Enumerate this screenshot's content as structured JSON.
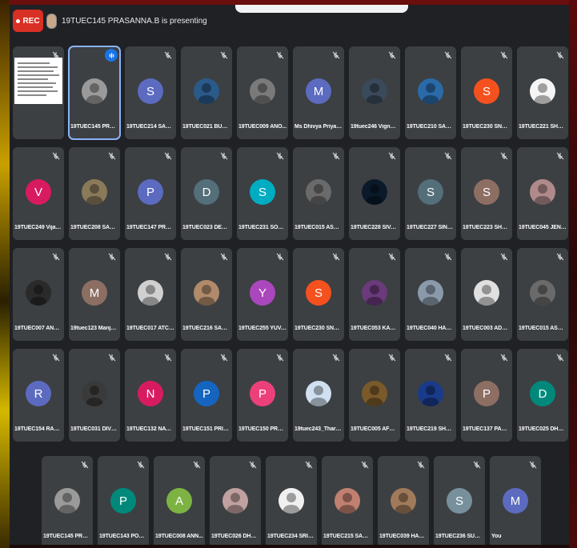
{
  "recording": {
    "label": "REC"
  },
  "presenting": {
    "text": "19TUEC145 PRASANNA.B is presenting"
  },
  "colors": {
    "background": "#202124",
    "tile": "#3c4043",
    "accent": "#1a73e8",
    "rec": "#d93025"
  },
  "participants": [
    {
      "name": "",
      "kind": "share",
      "mic": "muted"
    },
    {
      "name": "19TUEC145 PRASA...",
      "kind": "photo",
      "color": "#9a9a9a",
      "mic": "speaking",
      "selected": true
    },
    {
      "name": "19TUEC214 SARAN...",
      "kind": "letter",
      "letter": "S",
      "color": "#5c6bc0",
      "mic": "muted"
    },
    {
      "name": "19TUEC021 BUMIC...",
      "kind": "photo",
      "color": "#2a5a8a",
      "mic": "muted"
    },
    {
      "name": "19TUEC009 ANO...",
      "kind": "photo",
      "color": "#7a7a7a",
      "mic": "muted"
    },
    {
      "name": "Ms Dhivya Priya E ...",
      "kind": "letter",
      "letter": "M",
      "color": "#5c6bc0",
      "mic": "muted"
    },
    {
      "name": "19tuec246 Vignea...",
      "kind": "photo",
      "color": "#3a4a5a",
      "mic": "muted"
    },
    {
      "name": "19TUEC210 SANJA...",
      "kind": "photo",
      "color": "#2a6aa8",
      "mic": "muted"
    },
    {
      "name": "19TUEC230 SNEH...",
      "kind": "letter",
      "letter": "S",
      "color": "#f4511e",
      "mic": "muted"
    },
    {
      "name": "19TUEC221 SHAN...",
      "kind": "photo",
      "color": "#f5f5f5",
      "mic": "muted"
    },
    {
      "name": "19TUEC249 Vijaya...",
      "kind": "letter",
      "letter": "V",
      "color": "#d81b60",
      "mic": "muted"
    },
    {
      "name": "19TUEC208 SAMU...",
      "kind": "photo",
      "color": "#8a7a5a",
      "mic": "muted"
    },
    {
      "name": "19TUEC147 PRAVE...",
      "kind": "letter",
      "letter": "P",
      "color": "#5c6bc0",
      "mic": "muted"
    },
    {
      "name": "19TUEC023 DEEPI...",
      "kind": "letter",
      "letter": "D",
      "color": "#546e7a",
      "mic": "muted"
    },
    {
      "name": "19TUEC231 SOBIH...",
      "kind": "letter",
      "letter": "S",
      "color": "#00acc1",
      "mic": "muted"
    },
    {
      "name": "19TUEC015 ASWI...",
      "kind": "photo",
      "color": "#6a6a6a",
      "mic": "muted"
    },
    {
      "name": "19TUEC228 SIVANI...",
      "kind": "photo",
      "color": "#0a1a2a",
      "mic": "muted"
    },
    {
      "name": "19TUEC227 SINDH...",
      "kind": "letter",
      "letter": "S",
      "color": "#546e7a",
      "mic": "muted"
    },
    {
      "name": "19TUEC223 SHREE...",
      "kind": "letter",
      "letter": "S",
      "color": "#8d6e63",
      "mic": "muted"
    },
    {
      "name": "19TUEC045 JENIF...",
      "kind": "photo",
      "color": "#b08a8a",
      "mic": "muted"
    },
    {
      "name": "19TUEC007 ANBU...",
      "kind": "photo",
      "color": "#2a2a2a",
      "mic": "muted"
    },
    {
      "name": "19tuec123 Manjule...",
      "kind": "letter",
      "letter": "M",
      "color": "#8d6e63",
      "mic": "muted"
    },
    {
      "name": "19TUEC017 ATCHA...",
      "kind": "photo",
      "color": "#d0d0d0",
      "mic": "muted"
    },
    {
      "name": "19TUEC216 SARAT...",
      "kind": "photo",
      "color": "#b08a6a",
      "mic": "muted"
    },
    {
      "name": "19TUEC255 YUVA...",
      "kind": "letter",
      "letter": "Y",
      "color": "#ab47bc",
      "mic": "muted"
    },
    {
      "name": "19TUEC230 SNEH...",
      "kind": "letter",
      "letter": "S",
      "color": "#f4511e",
      "mic": "muted"
    },
    {
      "name": "19TUEC053 KART...",
      "kind": "photo",
      "color": "#6a3a7a",
      "mic": "muted"
    },
    {
      "name": "19TUEC040 HARIS...",
      "kind": "photo",
      "color": "#8a9aaa",
      "mic": "muted"
    },
    {
      "name": "19TUEC003 ADHA...",
      "kind": "photo",
      "color": "#e0e0e0",
      "mic": "muted"
    },
    {
      "name": "19TUEC015 ASWI...",
      "kind": "photo",
      "color": "#6a6a6a",
      "mic": "muted"
    },
    {
      "name": "19TUEC154 RAJA ...",
      "kind": "letter",
      "letter": "R",
      "color": "#5c6bc0",
      "mic": "muted"
    },
    {
      "name": "19TUEC031 DIVYA L",
      "kind": "photo",
      "color": "#3a3a3a",
      "mic": "muted"
    },
    {
      "name": "19TUEC132 NATRA...",
      "kind": "letter",
      "letter": "N",
      "color": "#d81b60",
      "mic": "muted"
    },
    {
      "name": "19TUEC151 PRIYA...",
      "kind": "letter",
      "letter": "P",
      "color": "#1565c0",
      "mic": "muted"
    },
    {
      "name": "19TUEC150 PREET...",
      "kind": "letter",
      "letter": "P",
      "color": "#ec407a",
      "mic": "muted"
    },
    {
      "name": "19tuec243_Tharu...",
      "kind": "photo",
      "color": "#d0e0f0",
      "mic": "muted"
    },
    {
      "name": "19TUEC005 AFRE...",
      "kind": "photo",
      "color": "#7a5a2a",
      "mic": "muted"
    },
    {
      "name": "19TUEC219 SHAN...",
      "kind": "photo",
      "color": "#1a3a8a",
      "mic": "muted"
    },
    {
      "name": "19TUEC137 PARVI...",
      "kind": "letter",
      "letter": "P",
      "color": "#8d6e63",
      "mic": "muted"
    },
    {
      "name": "19TUEC025 DHAK...",
      "kind": "letter",
      "letter": "D",
      "color": "#00897b",
      "mic": "muted"
    },
    {
      "name": "19TUEC145 PRASA...",
      "kind": "photo",
      "color": "#9a9a9a",
      "mic": "muted"
    },
    {
      "name": "19TUEC143 POOJ...",
      "kind": "letter",
      "letter": "P",
      "color": "#00897b",
      "mic": "muted"
    },
    {
      "name": "19TUEC008 ANN...",
      "kind": "letter",
      "letter": "A",
      "color": "#7cb342",
      "mic": "muted"
    },
    {
      "name": "19TUEC026 DHAR...",
      "kind": "photo",
      "color": "#c0a0a0",
      "mic": "muted"
    },
    {
      "name": "19TUEC234 SRIKA...",
      "kind": "photo",
      "color": "#f0f0f0",
      "mic": "muted"
    },
    {
      "name": "19TUEC215 SARAN...",
      "kind": "photo",
      "color": "#c08070",
      "mic": "muted"
    },
    {
      "name": "19TUEC039 HARI...",
      "kind": "photo",
      "color": "#a07a5a",
      "mic": "muted"
    },
    {
      "name": "19TUEC236 SUBHI...",
      "kind": "letter",
      "letter": "S",
      "color": "#78909c",
      "mic": "muted"
    },
    {
      "name": "You",
      "kind": "letter",
      "letter": "M",
      "color": "#5c6bc0",
      "mic": "muted"
    }
  ]
}
